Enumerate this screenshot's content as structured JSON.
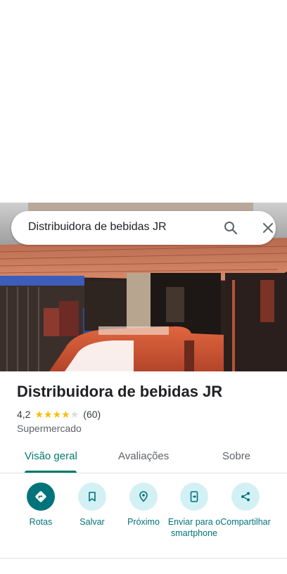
{
  "search": {
    "query": "Distribuidora de bebidas JR"
  },
  "place": {
    "name": "Distribuidora de bebidas JR",
    "rating": "4,2",
    "rating_value": 4.2,
    "stars_full": 4,
    "stars_total": 5,
    "review_count": "(60)",
    "category": "Supermercado"
  },
  "tabs": [
    {
      "label": "Visão geral",
      "active": true
    },
    {
      "label": "Avaliações",
      "active": false
    },
    {
      "label": "Sobre",
      "active": false
    }
  ],
  "actions": [
    {
      "label": "Rotas",
      "icon": "directions-icon"
    },
    {
      "label": "Salvar",
      "icon": "bookmark-icon"
    },
    {
      "label": "Próximo",
      "icon": "nearby-icon"
    },
    {
      "label": "Enviar para o smartphone",
      "icon": "send-to-phone-icon"
    },
    {
      "label": "Compartilhar",
      "icon": "share-icon"
    }
  ],
  "colors": {
    "accent": "#00737b",
    "accent_light": "#d3f1f5",
    "star": "#fbbc04",
    "tab_active": "#00796b"
  }
}
